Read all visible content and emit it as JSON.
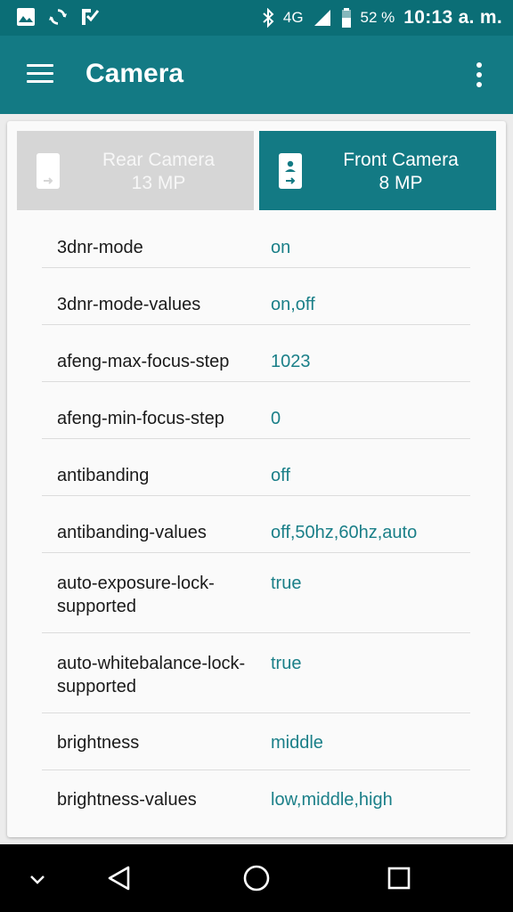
{
  "status_bar": {
    "icons_left": [
      "image-icon",
      "sync-icon",
      "flipboard-icon"
    ],
    "bluetooth": "bluetooth-icon",
    "network": "4G",
    "battery_percent": "52 %",
    "time": "10:13 a. m."
  },
  "app_bar": {
    "title": "Camera"
  },
  "tabs": [
    {
      "label": "Rear Camera",
      "sub": "13 MP",
      "selected": false
    },
    {
      "label": "Front Camera",
      "sub": "8 MP",
      "selected": true
    }
  ],
  "properties": [
    {
      "name": "3dnr-mode",
      "value": "on"
    },
    {
      "name": "3dnr-mode-values",
      "value": "on,off"
    },
    {
      "name": "afeng-max-focus-step",
      "value": "1023"
    },
    {
      "name": "afeng-min-focus-step",
      "value": "0"
    },
    {
      "name": "antibanding",
      "value": "off"
    },
    {
      "name": "antibanding-values",
      "value": "off,50hz,60hz,auto"
    },
    {
      "name": "auto-exposure-lock-supported",
      "value": "true"
    },
    {
      "name": "auto-whitebalance-lock-supported",
      "value": "true"
    },
    {
      "name": "brightness",
      "value": "middle"
    },
    {
      "name": "brightness-values",
      "value": "low,middle,high"
    }
  ],
  "colors": {
    "primary": "#137a84",
    "status_bar": "#0b6e76",
    "value_text": "#1a7f88"
  }
}
